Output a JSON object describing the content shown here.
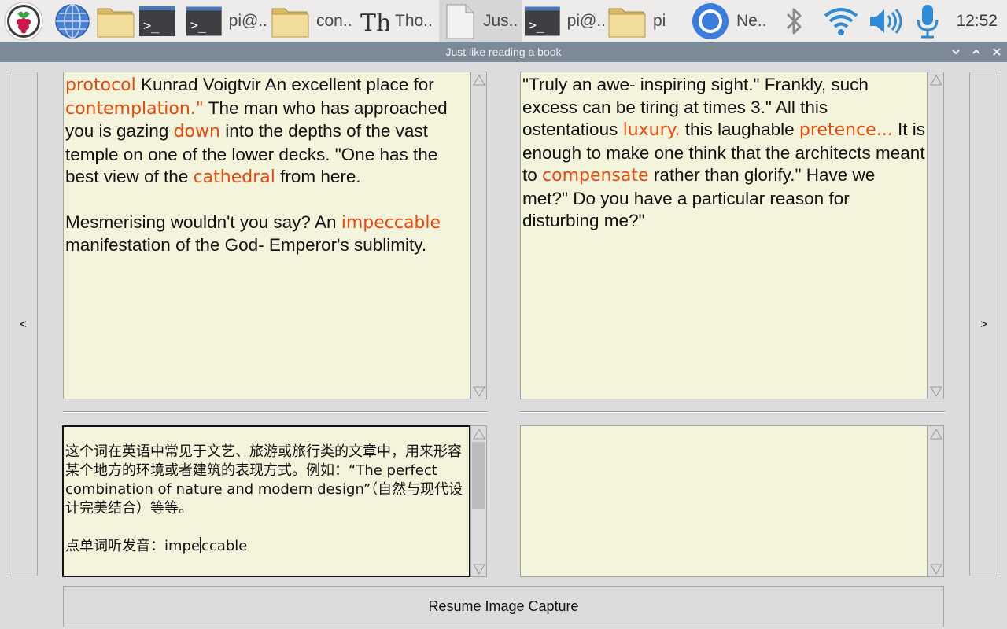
{
  "taskbar": {
    "items": [
      {
        "icon": "raspberry-menu-icon",
        "label": ""
      },
      {
        "icon": "globe-icon",
        "label": ""
      },
      {
        "icon": "folder-icon",
        "label": ""
      },
      {
        "icon": "terminal-icon",
        "label": ""
      },
      {
        "icon": "terminal-icon",
        "label": "pi@.."
      },
      {
        "icon": "folder-icon",
        "label": "con.."
      },
      {
        "icon": "thonny-icon",
        "label": "Tho.."
      },
      {
        "icon": "document-icon",
        "label": "Jus.."
      },
      {
        "icon": "terminal-icon",
        "label": "pi@.."
      },
      {
        "icon": "folder-icon",
        "label": "pi"
      },
      {
        "icon": "chromium-icon",
        "label": "Ne.."
      }
    ],
    "tray": [
      "bluetooth-icon",
      "wifi-icon",
      "volume-icon",
      "microphone-icon"
    ],
    "time": "12:52"
  },
  "window": {
    "title": "Just like reading a book"
  },
  "nav": {
    "prev_label": "<",
    "next_label": ">"
  },
  "left_page": [
    {
      "type": "para",
      "runs": [
        {
          "t": "protocol",
          "hl": true
        },
        {
          "t": " Kunrad Voigtvir An excellent place for "
        },
        {
          "t": "contemplation.\"",
          "hl": true
        },
        {
          "t": " The man who has approached you is gazing "
        },
        {
          "t": "down",
          "hl": true
        },
        {
          "t": " into the depths of the vast temple on one of the lower decks. \"One has the best view of the "
        },
        {
          "t": "cathedral",
          "hl": true
        },
        {
          "t": " from here."
        }
      ]
    },
    {
      "type": "para",
      "runs": [
        {
          "t": "Mesmerising wouldn't you say? An "
        },
        {
          "t": "impeccable",
          "hl": true
        },
        {
          "t": " manifestation of the God- Emperor's sublimity."
        }
      ]
    }
  ],
  "right_page": [
    {
      "type": "para",
      "runs": [
        {
          "t": "\"Truly an awe- inspiring sight.\" Frankly, such excess can be tiring at times 3.\" All this ostentatious "
        },
        {
          "t": "luxury.",
          "hl": true
        },
        {
          "t": " this laughable "
        },
        {
          "t": "pretence...",
          "hl": true
        },
        {
          "t": " It is enough to make one think that the architects meant to "
        },
        {
          "t": "compensate",
          "hl": true
        },
        {
          "t": " rather than glorify.\" Have we met?\" Do you have a particular reason for disturbing me?\""
        }
      ]
    }
  ],
  "definition": {
    "text": "这个词在英语中常见于文艺、旅游或旅行类的文章中，用来形容某个地方的环境或者建筑的表现方式。例如：“The perfect combination of nature and modern design”（自然与现代设计完美结合）等等。",
    "pronounce_prefix": "点单词听发音：",
    "word_before_caret": "impe",
    "word_after_caret": "ccable"
  },
  "translation": {
    "text": ""
  },
  "buttons": {
    "resume": "Resume Image Capture"
  },
  "colors": {
    "highlight": "#e84a0e",
    "page_bg": "#f4f4dc",
    "window_bg": "#dcdcdc",
    "titlebar": "#7c8a97"
  }
}
